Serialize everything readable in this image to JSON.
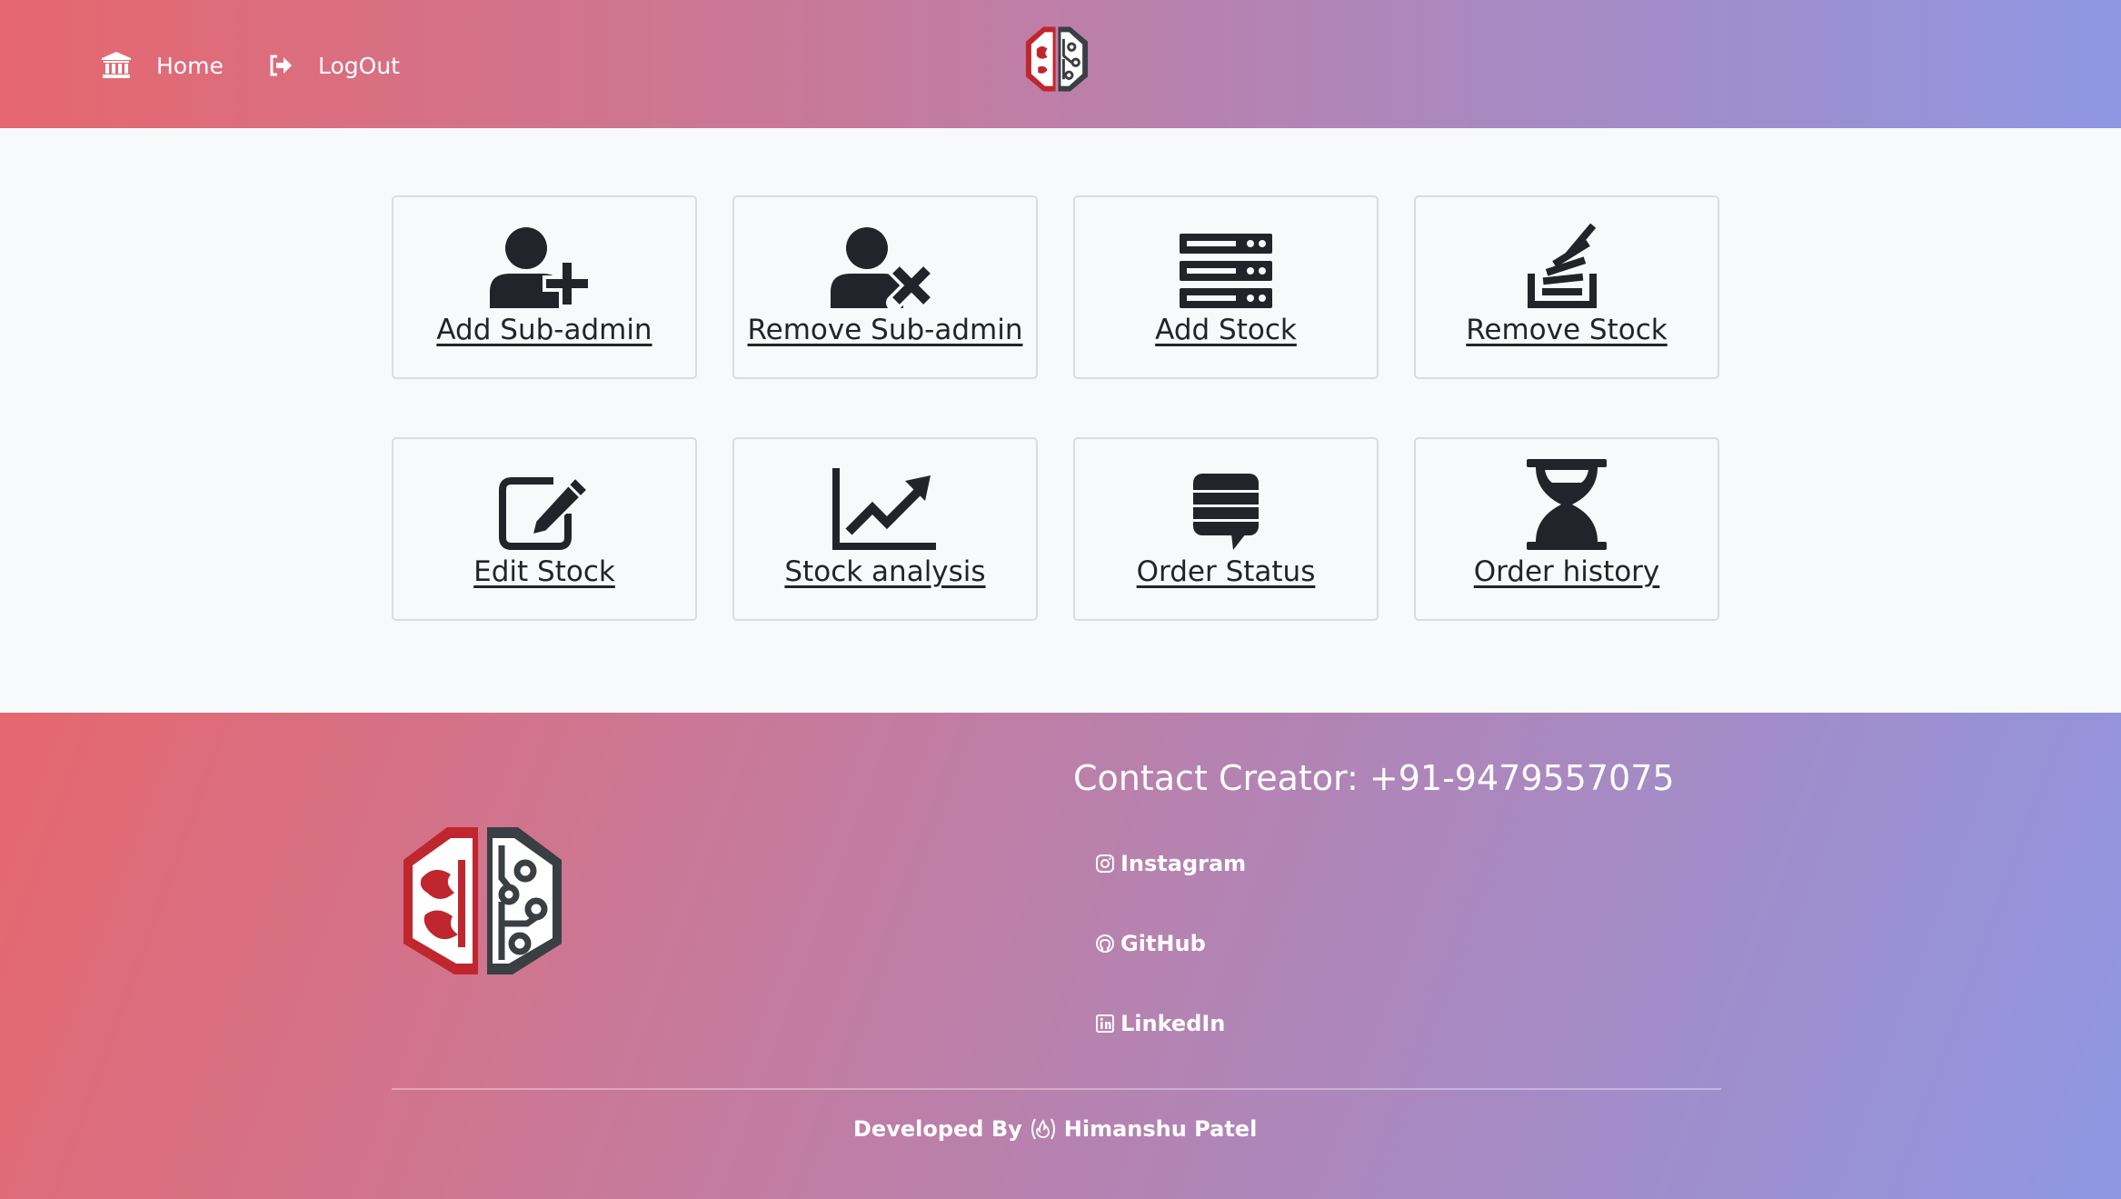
{
  "nav": {
    "home_label": "Home",
    "logout_label": "LogOut"
  },
  "cards": [
    {
      "label": "Add Sub-admin",
      "icon": "user-plus-icon"
    },
    {
      "label": "Remove Sub-admin",
      "icon": "user-remove-icon"
    },
    {
      "label": "Add Stock",
      "icon": "server-stack-icon"
    },
    {
      "label": "Remove Stock",
      "icon": "stack-overflow-icon"
    },
    {
      "label": "Edit Stock",
      "icon": "edit-icon"
    },
    {
      "label": "Stock analysis",
      "icon": "line-chart-icon"
    },
    {
      "label": "Order Status",
      "icon": "comment-lines-icon"
    },
    {
      "label": "Order history",
      "icon": "hourglass-icon"
    }
  ],
  "footer": {
    "contact": "Contact Creator: +91-9479557075",
    "social": [
      {
        "label": "Instagram",
        "icon": "instagram-icon"
      },
      {
        "label": "GitHub",
        "icon": "github-icon"
      },
      {
        "label": "LinkedIn",
        "icon": "linkedin-icon"
      }
    ],
    "credit_prefix": "Developed By",
    "credit_name": "Himanshu Patel"
  },
  "colors": {
    "gradient_start": "#e6676e",
    "gradient_end": "#8f97e3",
    "page_bg": "#f8f9fa",
    "icon_dark": "#212529",
    "logo_red": "#c0262d",
    "logo_dark": "#3a3f44"
  }
}
